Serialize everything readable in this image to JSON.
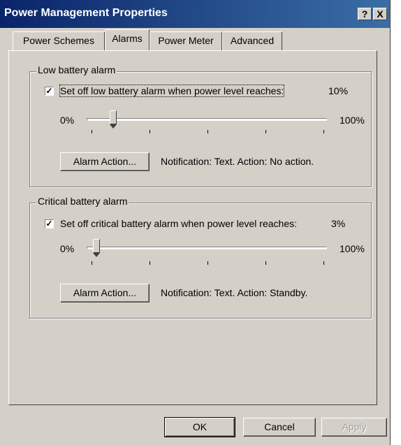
{
  "window": {
    "title": "Power Management Properties",
    "help_label": "?",
    "close_label": "X"
  },
  "tabs": [
    {
      "label": "Power Schemes"
    },
    {
      "label": "Alarms"
    },
    {
      "label": "Power Meter"
    },
    {
      "label": "Advanced"
    }
  ],
  "active_tab": "Alarms",
  "low_alarm": {
    "legend": "Low battery alarm",
    "enabled": true,
    "checkbox_label": "Set off low battery alarm when power level reaches:",
    "value_label": "10%",
    "level": 10,
    "min_label": "0%",
    "max_label": "100%",
    "button_label": "Alarm Action...",
    "notification": "Notification: Text. Action: No action."
  },
  "critical_alarm": {
    "legend": "Critical battery alarm",
    "enabled": true,
    "checkbox_label": "Set off critical battery alarm when power level reaches:",
    "value_label": "3%",
    "level": 3,
    "min_label": "0%",
    "max_label": "100%",
    "button_label": "Alarm Action...",
    "notification": "Notification: Text. Action: Standby."
  },
  "buttons": {
    "ok": "OK",
    "cancel": "Cancel",
    "apply": "Apply"
  }
}
